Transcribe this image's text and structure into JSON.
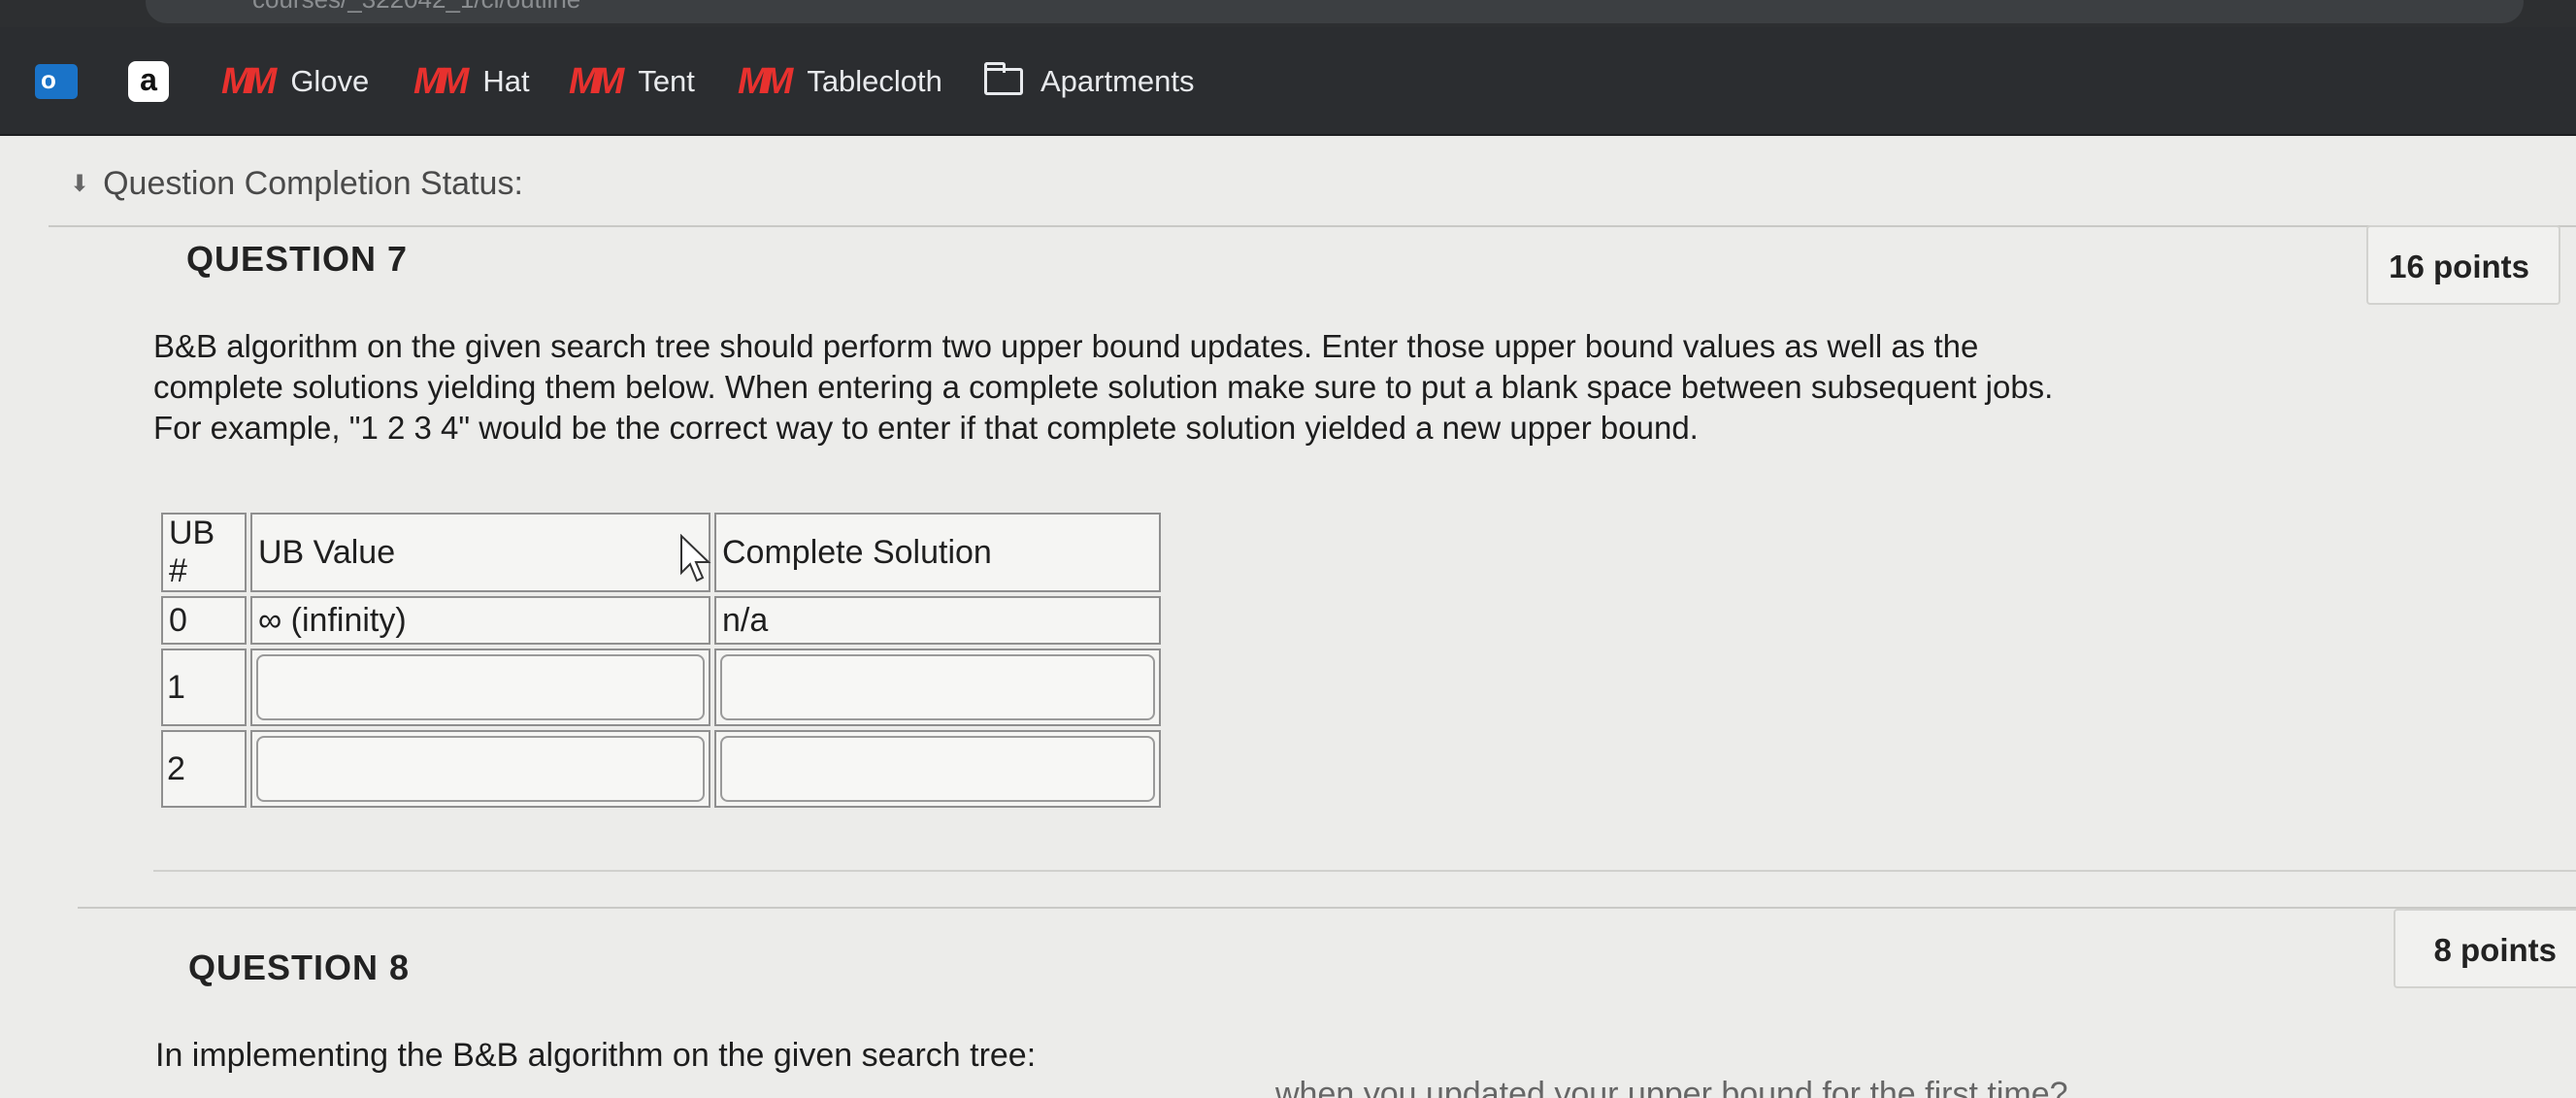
{
  "browser": {
    "url_fragment": "courses/_322042_1/cl/outline"
  },
  "bookmarks": [
    {
      "label": "",
      "icon": "outlook-icon"
    },
    {
      "label": "",
      "icon": "amazon-icon"
    },
    {
      "label": "Glove",
      "icon": "m-logo-icon"
    },
    {
      "label": "Hat",
      "icon": "m-logo-icon"
    },
    {
      "label": "Tent",
      "icon": "m-logo-icon"
    },
    {
      "label": "Tablecloth",
      "icon": "m-logo-icon"
    },
    {
      "label": "Apartments",
      "icon": "folder-icon"
    }
  ],
  "completion_status": {
    "label": "Question Completion Status:",
    "icon": "double-chevron-down-icon"
  },
  "question7": {
    "title": "QUESTION 7",
    "points": "16 points",
    "text": "B&B algorithm on the given search tree should perform two upper bound updates. Enter those upper bound values as well as the complete solutions yielding them below. When entering a complete solution make sure to put a blank space between subsequent jobs. For example, \"1 2 3 4\" would be the correct way to enter if that complete solution yielded a new upper bound.",
    "table": {
      "headers": [
        "UB #",
        "UB Value",
        "Complete Solution"
      ],
      "row0": [
        "0",
        "∞ (infinity)",
        "n/a"
      ],
      "row1": {
        "ub": "1",
        "value": "",
        "solution": ""
      },
      "row2": {
        "ub": "2",
        "value": "",
        "solution": ""
      }
    }
  },
  "question8": {
    "title": "QUESTION 8",
    "points": "8 points",
    "text": "In implementing the B&B algorithm on the given search tree:",
    "text_partial": "…when you updated your upper bound for the first time?"
  },
  "colors": {
    "chrome_bg": "#2b2d30",
    "page_bg": "#ececea",
    "m_logo": "#e8312e"
  }
}
